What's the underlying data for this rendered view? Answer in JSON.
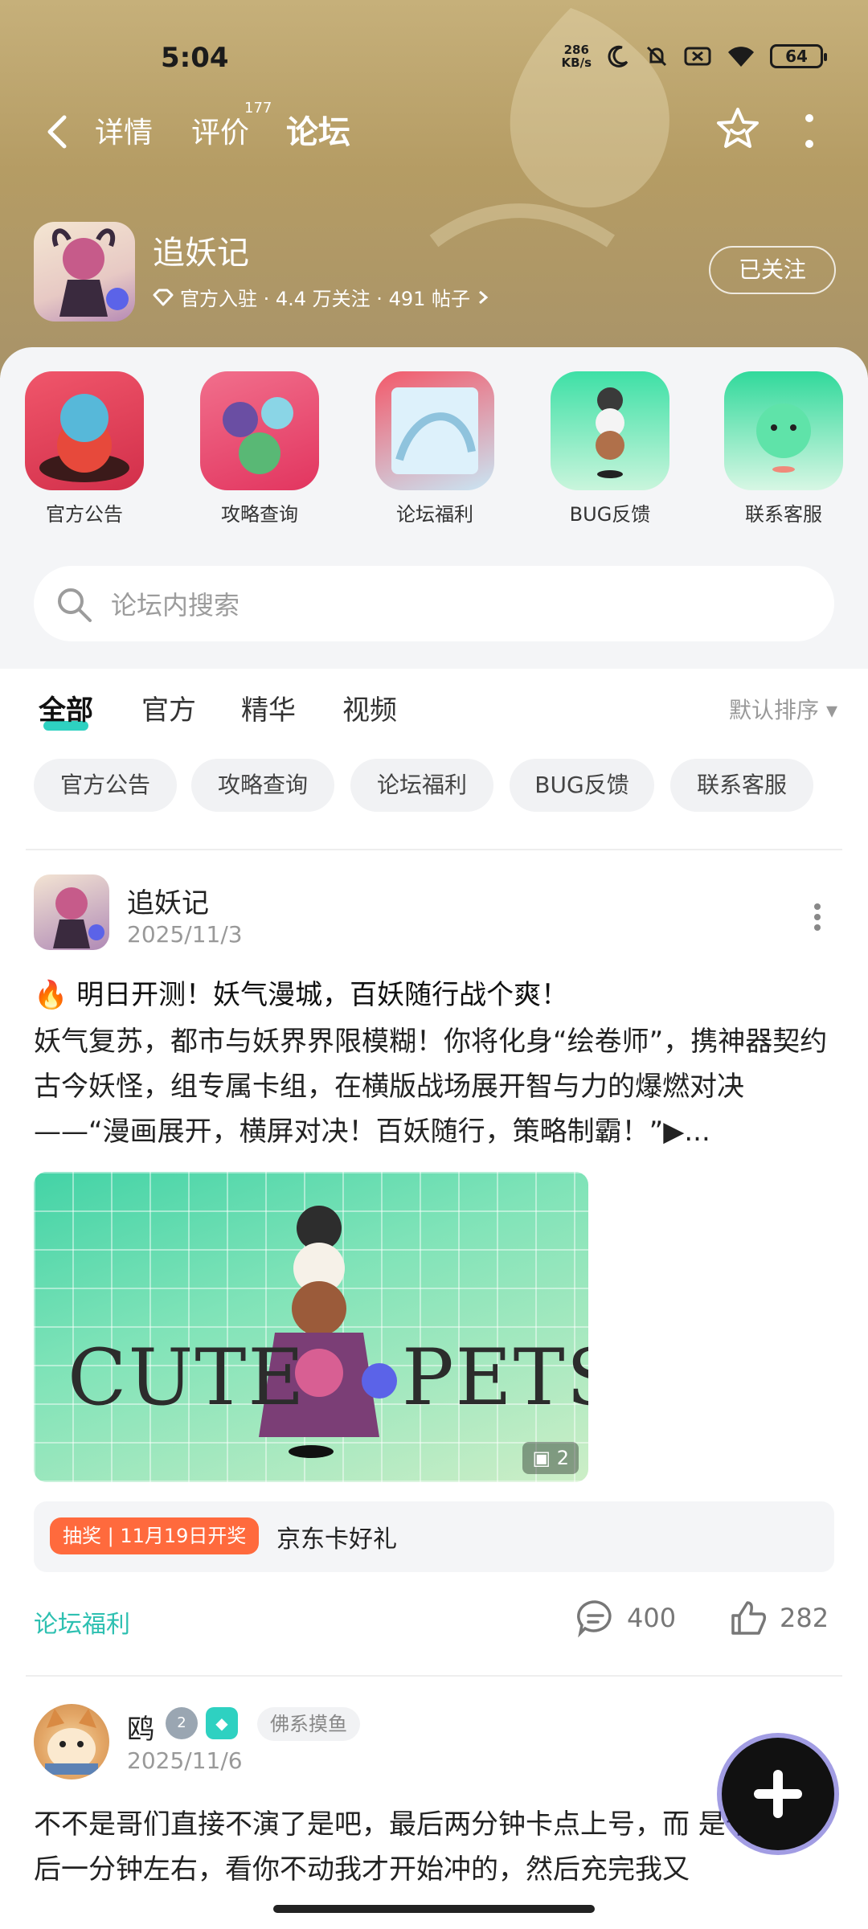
{
  "status_bar": {
    "time": "5:04",
    "speed_value": "286",
    "speed_unit": "KB/s",
    "battery": "64"
  },
  "nav": {
    "tabs": [
      "详情",
      "评价",
      "论坛"
    ],
    "review_count": "177",
    "active_tab": "论坛"
  },
  "game": {
    "name": "追妖记",
    "meta": "官方入驻 · 4.4 万关注 · 491 帖子",
    "follow_label": "已关注"
  },
  "shortcuts": [
    {
      "label": "官方公告"
    },
    {
      "label": "攻略查询"
    },
    {
      "label": "论坛福利"
    },
    {
      "label": "BUG反馈"
    },
    {
      "label": "联系客服"
    }
  ],
  "search": {
    "placeholder": "论坛内搜索"
  },
  "filter_tabs": [
    "全部",
    "官方",
    "精华",
    "视频"
  ],
  "sort_label": "默认排序",
  "chips": [
    "官方公告",
    "攻略查询",
    "论坛福利",
    "BUG反馈",
    "联系客服"
  ],
  "post1": {
    "author": "追妖记",
    "date": "2025/11/3",
    "title": "🔥 明日开测！妖气漫城，百妖随行战个爽！",
    "body": "妖气复苏，都市与妖界界限模糊！你将化身“绘卷师”，携神器契约古今妖怪，组专属卡组，在横版战场展开智与力的爆燃对决 ——“漫画展开，横屏对决！百妖随行，策略制霸！”▶...",
    "image_text_left": "CUTE",
    "image_text_right": "PETS",
    "image_count": "2",
    "prize_tag": "抽奖 | 11月19日开奖",
    "prize_text": "京东卡好礼",
    "forum": "论坛福利",
    "comments": "400",
    "likes": "282"
  },
  "post2": {
    "author": "鸥",
    "level": "2",
    "tag": "佛系摸鱼",
    "date": "2025/11/6",
    "body": "不不是哥们直接不演了是吧，最后两分钟卡点上号，而 是卡到最后一分钟左右，看你不动我才开始冲的，然后充完我又"
  },
  "colors": {
    "accent": "#2ed1c1",
    "prize_tag": "#ff6a3d"
  }
}
